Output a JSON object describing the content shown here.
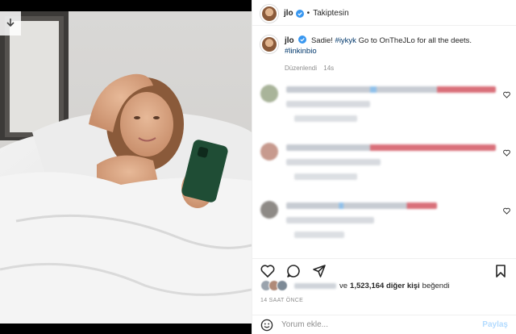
{
  "post": {
    "username": "jlo",
    "follow_status": "Takiptesin",
    "caption_text": "Sadie!",
    "caption_tag1": "#iykyk",
    "caption_mid": "Go to OnTheJLo for all the deets.",
    "caption_tag2": "#linkinbio",
    "edited_label": "Düzenlendi",
    "caption_age": "14s",
    "likes_connector": "ve",
    "likes_count": "1,523,164",
    "likes_suffix": "diğer kişi",
    "likes_tail": "beğendi",
    "time_ago": "14 SAAT ÖNCE"
  },
  "comment_box": {
    "placeholder": "Yorum ekle...",
    "post_label": "Paylaş"
  },
  "icons": {
    "download": "download-icon",
    "verified": "verified-badge-icon",
    "like": "heart-icon",
    "comment": "comment-bubble-icon",
    "share": "paper-plane-icon",
    "save": "bookmark-icon",
    "emoji": "smiley-icon"
  },
  "colors": {
    "verified": "#3897f0",
    "link": "#00376b",
    "secondary_text": "#8e8e8e",
    "post_button": "#b3dbff"
  }
}
